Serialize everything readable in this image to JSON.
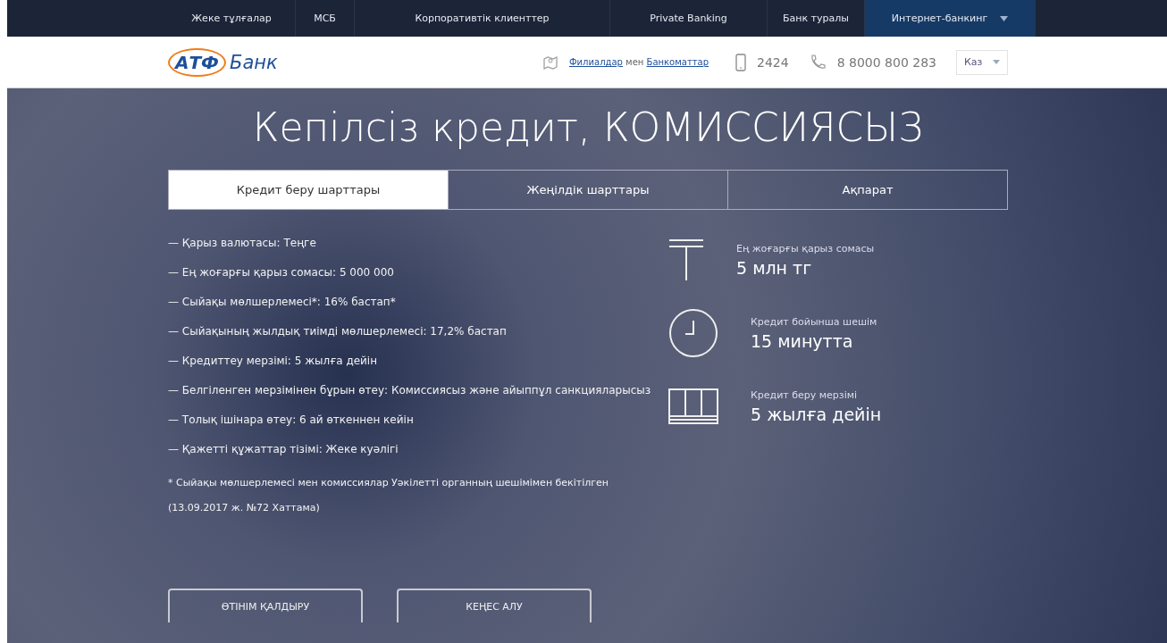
{
  "top_nav": [
    {
      "label": "Жеке тұлғалар",
      "selected": false
    },
    {
      "label": "МСБ",
      "selected": false
    },
    {
      "label": "Корпоративтік клиенттер",
      "selected": false
    },
    {
      "label": "Private Banking",
      "selected": false
    },
    {
      "label": "Банк туралы",
      "selected": false
    },
    {
      "label": "Интернет-банкинг",
      "selected": true,
      "dropdown": true
    }
  ],
  "header": {
    "logo_mark": "АТФ",
    "logo_text": "Банк",
    "branches_link": "Филиалдар",
    "branches_join": "мен",
    "atm_link": "Банкоматтар",
    "short_phone": "2424",
    "phone": "8 8000 800 283",
    "language": "Каз"
  },
  "hero": {
    "title": "Кепілсіз кредит, КОМИССИЯСЫЗ",
    "tabs": [
      {
        "label": "Кредит беру шарттары",
        "selected": true
      },
      {
        "label": "Жеңілдік шарттары",
        "selected": false
      },
      {
        "label": "Ақпарат",
        "selected": false
      }
    ],
    "conditions": [
      "— Қарыз валютасы: Теңге",
      "— Ең жоғарғы қарыз сомасы: 5 000 000",
      "— Сыйақы мөлшерлемесі*: 16% бастап*",
      "— Сыйақының жылдық тиімді мөлшерлемесі: 17,2% бастап",
      "— Кредиттеу мерзімі: 5 жылға дейін",
      "— Белгіленген мерзімінен бұрын өтеу: Комиссиясыз және айыппұл санкцияларысыз",
      "— Толық ішінара өтеу: 6 ай өткеннен кейін",
      "— Қажетті құжаттар тізімі: Жеке куәлігі"
    ],
    "footnote": "* Сыйақы мөлшерлемесі мен комиссиялар Уәкілетті органның шешімімен бекітілген (13.09.2017 ж. №72 Хаттама)",
    "features": [
      {
        "kind": "tenge",
        "label": "Ең жоғарғы қарыз сомасы",
        "value": "5 млн тг"
      },
      {
        "kind": "clock",
        "label": "Кредит бойынша шешім",
        "value": "15 минутта"
      },
      {
        "kind": "calendar",
        "label": "Кредит беру мерзімі",
        "value": "5 жылға дейін"
      }
    ],
    "buttons": [
      "ӨТІНІМ ҚАЛДЫРУ",
      "КЕҢЕС АЛУ"
    ]
  }
}
